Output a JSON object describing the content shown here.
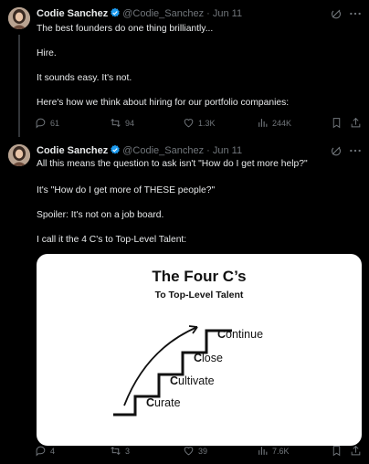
{
  "tweets": [
    {
      "author": {
        "name": "Codie Sanchez",
        "handle": "@Codie_Sanchez",
        "separator": "·",
        "date": "Jun 11",
        "verified": true
      },
      "lines": [
        "The best founders do one thing brilliantly...",
        "Hire.",
        "It sounds easy. It's not.",
        "Here's how we think about hiring for our portfolio companies:"
      ],
      "stats": {
        "replies": "61",
        "reposts": "94",
        "likes": "1.3K",
        "views": "244K"
      }
    },
    {
      "author": {
        "name": "Codie Sanchez",
        "handle": "@Codie_Sanchez",
        "separator": "·",
        "date": "Jun 11",
        "verified": true
      },
      "lines": [
        "All this means the question to ask isn't \"How do I get more help?\"",
        "It's \"How do I get more of THESE people?\"",
        "Spoiler: It's not on a job board.",
        "I call it the 4 C's to Top-Level Talent:"
      ],
      "image": {
        "title": "The Four C’s",
        "subtitle": "To Top-Level Talent",
        "steps": [
          {
            "initial": "C",
            "rest": "urate"
          },
          {
            "initial": "C",
            "rest": "ultivate"
          },
          {
            "initial": "C",
            "rest": "lose"
          },
          {
            "initial": "C",
            "rest": "ontinue"
          }
        ]
      },
      "stats": {
        "replies": "4",
        "reposts": "3",
        "likes": "39",
        "views": "7.6K"
      }
    }
  ],
  "icons": {
    "reply": "reply-icon",
    "repost": "repost-icon",
    "like": "heart-icon",
    "views": "views-icon",
    "bookmark": "bookmark-icon",
    "share": "share-icon",
    "grok": "grok-icon",
    "more": "more-icon"
  },
  "colors": {
    "background": "#000000",
    "text": "#e7e9ea",
    "muted": "#71767b",
    "verified": "#1d9bf0",
    "card": "#ffffff"
  }
}
